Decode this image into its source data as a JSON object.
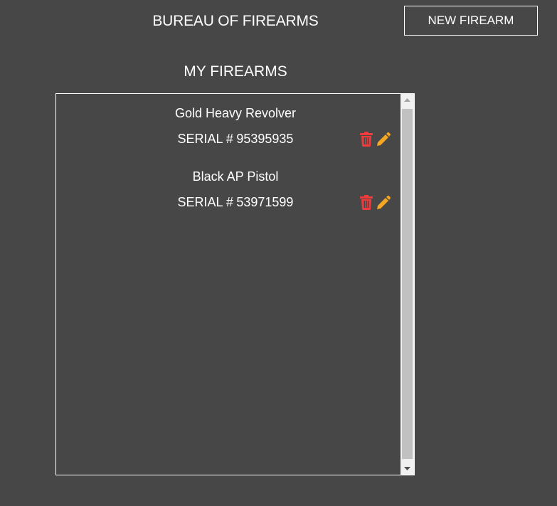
{
  "header": {
    "title": "BUREAU OF FIREARMS",
    "new_button_label": "NEW FIREARM"
  },
  "main": {
    "section_title": "MY FIREARMS",
    "firearms": [
      {
        "name": "Gold Heavy Revolver",
        "serial_prefix": "SERIAL #",
        "serial_number": "95395935"
      },
      {
        "name": "Black AP Pistol",
        "serial_prefix": "SERIAL #",
        "serial_number": "53971599"
      }
    ]
  },
  "icons": {
    "delete": "trash-icon",
    "edit": "pencil-icon",
    "scroll_up": "triangle-up-icon",
    "scroll_down": "triangle-down-icon"
  },
  "colors": {
    "background": "#474747",
    "text": "#ffffff",
    "delete": "#ee3b3b",
    "edit": "#f5a623",
    "scrollbar_track": "#f1f1f1",
    "scrollbar_thumb": "#c1c1c1"
  }
}
